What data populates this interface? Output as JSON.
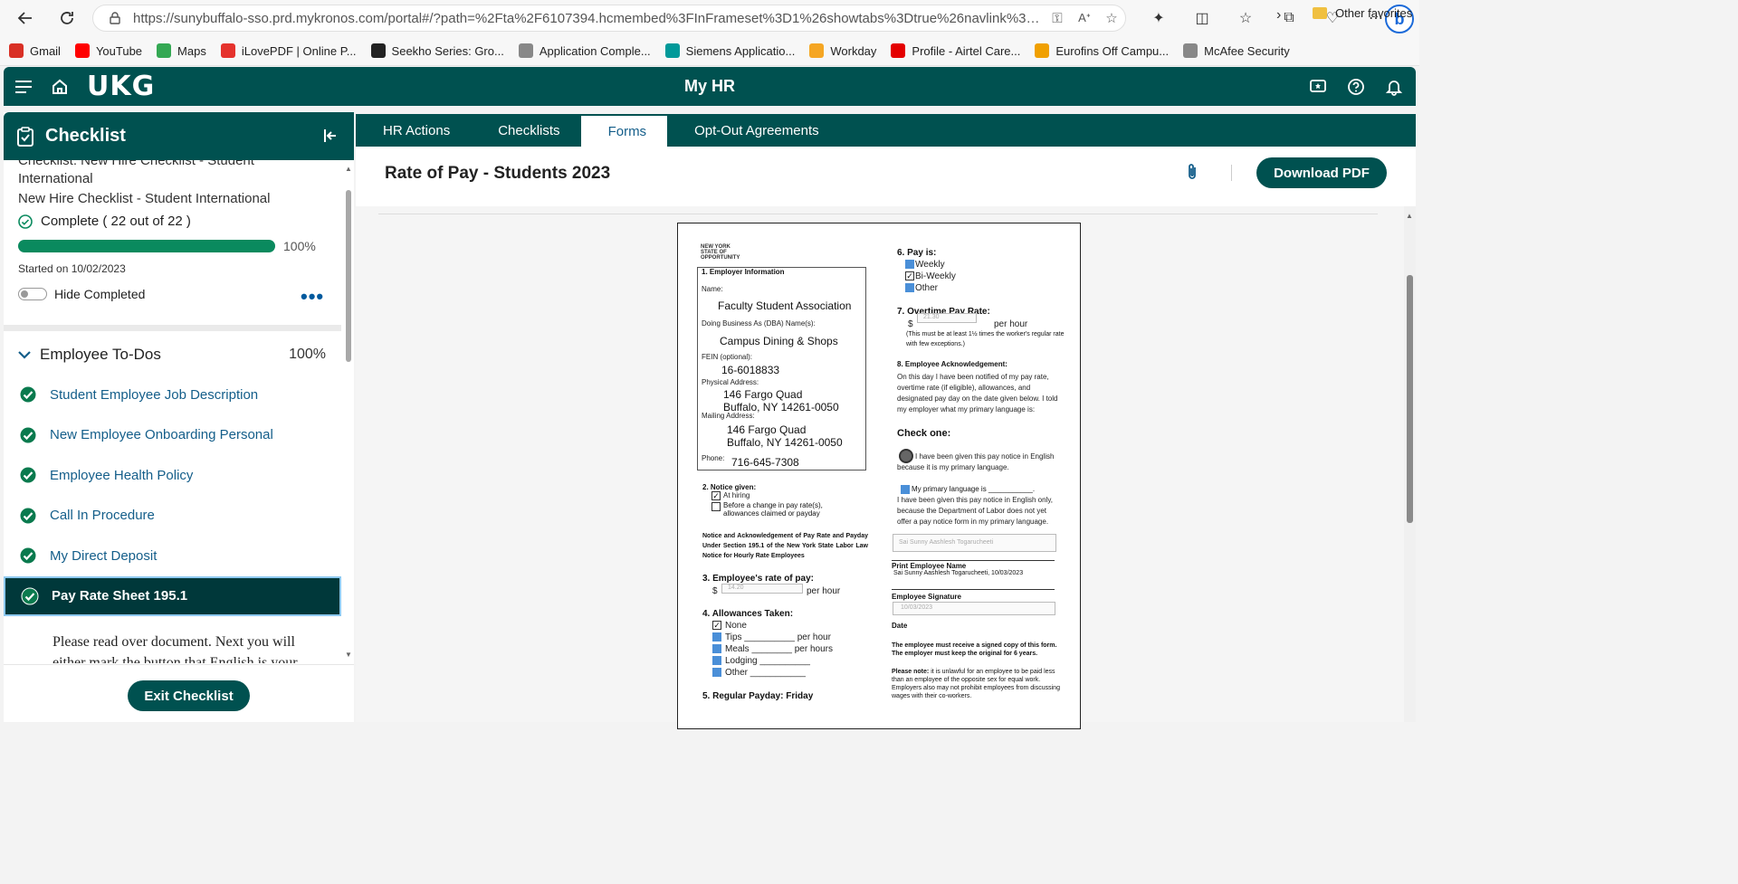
{
  "browser": {
    "url": "https://sunybuffalo-sso.prd.mykronos.com/portal#/?path=%2Fta%2F6107394.hcmembed%3FInFrameset%3D1%26showtabs%3Dtrue%26navlink%3Dhr...",
    "profile_initial": "b"
  },
  "favorites": [
    {
      "label": "Gmail",
      "color": "#d93025"
    },
    {
      "label": "YouTube",
      "color": "#ff0000"
    },
    {
      "label": "Maps",
      "color": "#34a853"
    },
    {
      "label": "iLovePDF | Online P...",
      "color": "#e5322d"
    },
    {
      "label": "Seekho Series: Gro...",
      "color": "#222222"
    },
    {
      "label": "Application Comple...",
      "color": "#888888"
    },
    {
      "label": "Siemens Applicatio...",
      "color": "#009999"
    },
    {
      "label": "Workday",
      "color": "#f5a623"
    },
    {
      "label": "Profile - Airtel Care...",
      "color": "#e40000"
    },
    {
      "label": "Eurofins Off Campu...",
      "color": "#f0a000"
    },
    {
      "label": "McAfee Security",
      "color": "#888888"
    }
  ],
  "favorites_other": "Other favorites",
  "app": {
    "logo": "UKG",
    "title": "My HR"
  },
  "sidebar": {
    "title": "Checklist",
    "cut_text": "Checklist: New Hire Checklist - Student International",
    "subtitle": "New Hire Checklist - Student International",
    "complete_text": "Complete ( 22 out of 22 )",
    "progress": 100,
    "progress_label": "100%",
    "started": "Started on 10/02/2023",
    "hide_completed": "Hide Completed",
    "section_title": "Employee To-Dos",
    "section_pct": "100%",
    "items": [
      {
        "label": "Student Employee Job Description"
      },
      {
        "label": "New Employee Onboarding Personal"
      },
      {
        "label": "Employee Health Policy"
      },
      {
        "label": "Call In Procedure"
      },
      {
        "label": "My Direct Deposit"
      },
      {
        "label": "Pay Rate Sheet 195.1"
      }
    ],
    "instructions": "Please read over document. Next you will either mark the button that English is your",
    "exit_button": "Exit Checklist"
  },
  "tabs": [
    {
      "label": "HR Actions"
    },
    {
      "label": "Checklists"
    },
    {
      "label": "Forms"
    },
    {
      "label": "Opt-Out Agreements"
    }
  ],
  "form": {
    "title": "Rate of Pay - Students 2023",
    "download": "Download PDF"
  },
  "document": {
    "logo": "NEW YORK STATE OF OPPORTUNITY",
    "s1_title": "1. Employer Information",
    "name_label": "Name:",
    "name_value": "Faculty Student Association",
    "dba_label": "Doing Business As (DBA) Name(s):",
    "dba_value": "Campus Dining & Shops",
    "fein_label": "FEIN (optional):",
    "fein_value": "16-6018833",
    "phys_label": "Physical Address:",
    "phys_line1": "146 Fargo Quad",
    "phys_line2": "Buffalo, NY 14261-0050",
    "mail_label": "Mailing Address:",
    "mail_line1": "146 Fargo Quad",
    "mail_line2": "Buffalo, NY 14261-0050",
    "phone_label": "Phone:",
    "phone_value": "716-645-7308",
    "s2_title": "2. Notice given:",
    "at_hiring": "At hiring",
    "before_change": "Before a change in pay rate(s), allowances claimed or payday",
    "notice_text": "Notice and Acknowledgement of Pay Rate and Payday Under Section 195.1 of the New York State Labor Law Notice for Hourly Rate Employees",
    "s3_title": "3. Employee's rate of pay:",
    "rate_value": "14.20",
    "per_hour": "per hour",
    "s4_title": "4. Allowances Taken:",
    "allow_none": "None",
    "allow_tips": "Tips __________ per hour",
    "allow_meals": "Meals ________ per hours",
    "allow_lodging": "Lodging __________",
    "allow_other": "Other ___________",
    "s5_title": "5. Regular Payday: Friday",
    "s6_title": "6. Pay is:",
    "pay_weekly": "Weekly",
    "pay_biweekly": "Bi-Weekly",
    "pay_other": "Other",
    "s7_title": "7. Overtime Pay Rate:",
    "ot_value": "21.30",
    "ot_note": "(This must be at least 1½ times the worker's regular rate with few exceptions.)",
    "s8_title": "8. Employee Acknowledgement:",
    "ack_text": "On this day I have been notified of my pay rate, overtime rate (if eligible), allowances, and designated pay day on the date given below. I told my employer what my primary language is:",
    "check_one": "Check one:",
    "opt1": "I have been given this pay notice in English because it is my primary language.",
    "opt2a": "My primary language is ___________.",
    "opt2b": "I have been given this pay notice in English only, because the Department of Labor does not yet offer a pay notice form in my primary language.",
    "print_name_value": "Sai Sunny Aashlesh Togarucheeti",
    "print_name_label": "Print Employee Name",
    "signature_value": "Sai Sunny Aashlesh Togarucheeti, 10/03/2023",
    "signature_label": "Employee Signature",
    "date_value": "10/03/2023",
    "date_label": "Date",
    "footer1": "The employee must receive a signed copy of this form. The employer must keep the original for 6 years.",
    "footer2_bold": "Please note:",
    "footer2": "it is unlawful for an employee to be paid less than an employee of the opposite sex for equal work. Employers also may not prohibit employees from discussing wages with their co-workers."
  }
}
